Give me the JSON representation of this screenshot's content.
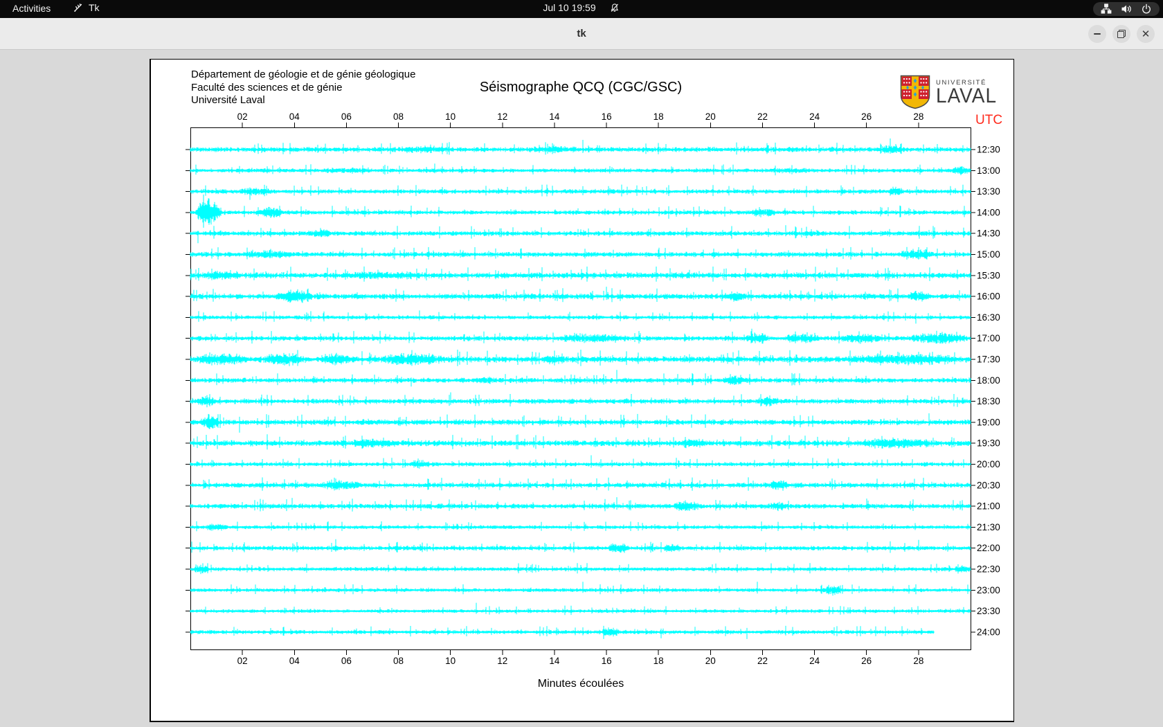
{
  "topbar": {
    "activities": "Activities",
    "app_name": "Tk",
    "clock": "Jul 10  19:59"
  },
  "window": {
    "title": "tk"
  },
  "icons": {
    "close": "✕"
  },
  "colors": {
    "trace": "#00ffff",
    "axis": "#000000",
    "utc_label": "#ff2a1c",
    "canvas_bg": "#ffffff",
    "window_bg": "#d9d9d9",
    "topbar_bg": "#0a0a0a",
    "titlebar_bg": "#ebebeb",
    "logo_red": "#cf202e",
    "logo_gold": "#f2b705",
    "logo_blue": "#2a9fd8"
  },
  "canvas": {
    "header_lines": [
      "Département de géologie et de génie géologique",
      "Faculté des sciences et de génie",
      "Université Laval"
    ],
    "title": "Séismographe QCQ (CGC/GSC)",
    "utc": "UTC",
    "xlabel": "Minutes écoulées",
    "logo": {
      "top": "UNIVERSITÉ",
      "name": "LAVAL"
    }
  },
  "chart_data": {
    "type": "seismogram-helicorder",
    "title": "Séismographe QCQ (CGC/GSC)",
    "xlabel": "Minutes écoulées",
    "ylabel": "UTC",
    "x_range_minutes": [
      0,
      30
    ],
    "x_tick_minutes": [
      2,
      4,
      6,
      8,
      10,
      12,
      14,
      16,
      18,
      20,
      22,
      24,
      26,
      28
    ],
    "x_tick_labels": [
      "02",
      "04",
      "06",
      "08",
      "10",
      "12",
      "14",
      "16",
      "18",
      "20",
      "22",
      "24",
      "26",
      "28"
    ],
    "minutes_per_row": 30,
    "rows": [
      {
        "time": "12:30",
        "base": 2.2,
        "bursts": [
          [
            8,
            10,
            1.5
          ],
          [
            13,
            15,
            1.5
          ],
          [
            26.6,
            27.3,
            4
          ]
        ],
        "spikes": [
          [
            11.3,
            9,
            4
          ],
          [
            15.1,
            14,
            5
          ],
          [
            18.3,
            8,
            3
          ],
          [
            23.7,
            6,
            3
          ],
          [
            26.9,
            16,
            6
          ]
        ]
      },
      {
        "time": "13:00",
        "base": 1.8,
        "bursts": [
          [
            5,
            7,
            1
          ],
          [
            22,
            24,
            1
          ],
          [
            29.3,
            30,
            3
          ]
        ],
        "spikes": [
          [
            9.4,
            10,
            4
          ],
          [
            10.1,
            5,
            3
          ],
          [
            16.2,
            5,
            2
          ],
          [
            22.5,
            7,
            7
          ],
          [
            29.6,
            5,
            5
          ]
        ]
      },
      {
        "time": "13:30",
        "base": 2.0,
        "bursts": [
          [
            1.8,
            3.2,
            2.5
          ],
          [
            26.8,
            27.4,
            3
          ]
        ],
        "spikes": [
          [
            2.3,
            6,
            12
          ],
          [
            12.9,
            7,
            3
          ],
          [
            20.9,
            5,
            2
          ],
          [
            23.7,
            8,
            8
          ]
        ]
      },
      {
        "time": "14:00",
        "base": 2.0,
        "bursts": [
          [
            0.2,
            1.2,
            14
          ],
          [
            2.6,
            3.6,
            4
          ],
          [
            21.5,
            22.5,
            3.5
          ]
        ],
        "spikes": [
          [
            0.5,
            26,
            22
          ],
          [
            3.0,
            8,
            4
          ],
          [
            6.0,
            9,
            3
          ],
          [
            9.1,
            7,
            3
          ],
          [
            14.9,
            6,
            2
          ],
          [
            18.4,
            9,
            9
          ],
          [
            18.7,
            6,
            6
          ],
          [
            26.6,
            7,
            3
          ]
        ]
      },
      {
        "time": "14:30",
        "base": 2.2,
        "bursts": [
          [
            4.5,
            5.5,
            2
          ]
        ],
        "spikes": [
          [
            0.3,
            4,
            14
          ],
          [
            5.0,
            8,
            3
          ],
          [
            12.4,
            9,
            4
          ],
          [
            15.0,
            6,
            3
          ],
          [
            22.9,
            12,
            4
          ],
          [
            26.2,
            5,
            3
          ],
          [
            28.0,
            4,
            4
          ]
        ]
      },
      {
        "time": "15:00",
        "base": 2.2,
        "bursts": [
          [
            2,
            4,
            2.5
          ],
          [
            27.3,
            28.6,
            4
          ]
        ],
        "spikes": [
          [
            3.1,
            8,
            3
          ],
          [
            18.0,
            7,
            3
          ],
          [
            23.0,
            6,
            4
          ],
          [
            27.8,
            8,
            6
          ]
        ]
      },
      {
        "time": "15:30",
        "base": 2.6,
        "bursts": [
          [
            0.5,
            2.0,
            3
          ],
          [
            6,
            9,
            1.5
          ]
        ],
        "spikes": [
          [
            2.9,
            6,
            3
          ],
          [
            19.2,
            8,
            4
          ],
          [
            24.4,
            7,
            3
          ]
        ]
      },
      {
        "time": "16:00",
        "base": 2.4,
        "bursts": [
          [
            3.3,
            4.7,
            5
          ],
          [
            20.6,
            21.4,
            4
          ],
          [
            27.6,
            28.4,
            4
          ]
        ],
        "spikes": [
          [
            2.8,
            7,
            3
          ],
          [
            10.5,
            6,
            3
          ],
          [
            16.0,
            14,
            5
          ],
          [
            24.6,
            6,
            3
          ],
          [
            28.0,
            6,
            4
          ]
        ]
      },
      {
        "time": "16:30",
        "base": 1.8,
        "bursts": [],
        "spikes": [
          [
            2.8,
            8,
            4
          ],
          [
            5.1,
            6,
            3
          ],
          [
            8.8,
            10,
            4
          ],
          [
            13.0,
            7,
            3
          ],
          [
            16.4,
            4,
            2
          ],
          [
            27.9,
            6,
            9
          ]
        ]
      },
      {
        "time": "17:00",
        "base": 2.2,
        "bursts": [
          [
            14.2,
            16.8,
            3
          ],
          [
            21.3,
            22.2,
            4
          ],
          [
            22.8,
            24.2,
            3.5
          ],
          [
            25.0,
            26.6,
            3.5
          ],
          [
            27.6,
            29.9,
            4
          ]
        ],
        "spikes": [
          [
            5.5,
            7,
            3
          ],
          [
            7.0,
            6,
            3
          ],
          [
            11.9,
            8,
            4
          ],
          [
            21.6,
            14,
            6
          ],
          [
            24.0,
            8,
            4
          ]
        ]
      },
      {
        "time": "17:30",
        "base": 2.8,
        "bursts": [
          [
            0.3,
            2.2,
            4
          ],
          [
            2.8,
            4.4,
            4.5
          ],
          [
            5.0,
            6.2,
            4
          ],
          [
            7.3,
            9.7,
            4.5
          ],
          [
            13.5,
            14.5,
            2.5
          ],
          [
            25.5,
            29.5,
            3.5
          ]
        ],
        "spikes": [
          [
            6.9,
            8,
            4
          ],
          [
            12.6,
            7,
            8
          ],
          [
            19.0,
            6,
            3
          ],
          [
            22.4,
            6,
            3
          ]
        ]
      },
      {
        "time": "18:00",
        "base": 2.2,
        "bursts": [
          [
            10.8,
            11.8,
            2
          ],
          [
            20.5,
            21.3,
            3.5
          ]
        ],
        "spikes": [
          [
            4.4,
            6,
            3
          ],
          [
            8.5,
            4,
            9
          ],
          [
            16.4,
            15,
            5
          ],
          [
            25.6,
            6,
            3
          ],
          [
            29.3,
            5,
            3
          ]
        ]
      },
      {
        "time": "18:30",
        "base": 2.2,
        "bursts": [
          [
            0.2,
            1.0,
            4
          ],
          [
            21.8,
            22.6,
            3.5
          ]
        ],
        "spikes": [
          [
            4.0,
            5,
            2
          ],
          [
            10.0,
            13,
            5
          ],
          [
            29.5,
            6,
            8
          ]
        ]
      },
      {
        "time": "19:00",
        "base": 2.4,
        "bursts": [
          [
            0.4,
            1.1,
            6
          ]
        ],
        "spikes": [
          [
            0.7,
            12,
            6
          ],
          [
            1.9,
            8,
            15
          ],
          [
            9.6,
            8,
            4
          ],
          [
            23.2,
            5,
            3
          ],
          [
            28.4,
            13,
            5
          ]
        ]
      },
      {
        "time": "19:30",
        "base": 2.6,
        "bursts": [
          [
            6.2,
            8.0,
            3
          ],
          [
            18.9,
            19.8,
            3
          ],
          [
            25.8,
            28.6,
            3.5
          ]
        ],
        "spikes": [
          [
            0.9,
            6,
            3
          ],
          [
            6.6,
            7,
            3
          ],
          [
            23.5,
            6,
            3
          ]
        ]
      },
      {
        "time": "20:00",
        "base": 1.9,
        "bursts": [
          [
            8.4,
            9.2,
            3
          ]
        ],
        "spikes": [
          [
            8.8,
            6,
            3
          ],
          [
            15.4,
            13,
            5
          ],
          [
            24.1,
            5,
            3
          ],
          [
            26.8,
            7,
            3
          ]
        ]
      },
      {
        "time": "20:30",
        "base": 2.3,
        "bursts": [
          [
            5.0,
            6.6,
            3
          ],
          [
            22.3,
            23.0,
            3.5
          ]
        ],
        "spikes": [
          [
            12.7,
            5,
            3
          ],
          [
            19.6,
            7,
            4
          ],
          [
            24.6,
            6,
            3
          ],
          [
            29.0,
            5,
            2
          ]
        ]
      },
      {
        "time": "21:00",
        "base": 2.2,
        "bursts": [
          [
            18.6,
            19.6,
            4
          ],
          [
            22.3,
            23.0,
            3
          ]
        ],
        "spikes": [
          [
            2.0,
            6,
            4
          ],
          [
            3.9,
            12,
            5
          ],
          [
            10.8,
            6,
            3
          ],
          [
            12.1,
            5,
            3
          ],
          [
            16.4,
            13,
            5
          ],
          [
            21.0,
            6,
            3
          ],
          [
            26.0,
            11,
            4
          ]
        ]
      },
      {
        "time": "21:30",
        "base": 1.7,
        "bursts": [
          [
            0.6,
            1.4,
            2.5
          ]
        ],
        "spikes": [
          [
            10.8,
            6,
            3
          ],
          [
            15.2,
            5,
            2
          ],
          [
            24.5,
            4,
            2
          ]
        ]
      },
      {
        "time": "22:00",
        "base": 2.0,
        "bursts": [
          [
            16.1,
            16.9,
            4
          ],
          [
            18.2,
            18.9,
            3
          ]
        ],
        "spikes": [
          [
            5.6,
            13,
            5
          ],
          [
            11.8,
            6,
            3
          ],
          [
            13.1,
            5,
            2
          ],
          [
            21.0,
            5,
            2
          ],
          [
            28.0,
            12,
            4
          ]
        ]
      },
      {
        "time": "22:30",
        "base": 1.8,
        "bursts": [
          [
            0.1,
            0.7,
            3
          ],
          [
            29.4,
            30,
            3.5
          ]
        ],
        "spikes": [
          [
            9.0,
            4,
            2
          ],
          [
            15.0,
            6,
            3
          ]
        ]
      },
      {
        "time": "23:00",
        "base": 1.7,
        "bursts": [
          [
            24.3,
            25.1,
            4
          ]
        ],
        "spikes": [
          [
            15.1,
            12,
            4
          ],
          [
            21.8,
            12,
            5
          ],
          [
            23.1,
            4,
            2
          ]
        ]
      },
      {
        "time": "23:30",
        "base": 1.6,
        "bursts": [],
        "spikes": [
          [
            11.0,
            12,
            4
          ],
          [
            16.0,
            4,
            2
          ],
          [
            21.1,
            5,
            2
          ]
        ]
      },
      {
        "time": "24:00",
        "base": 1.8,
        "end": 28.6,
        "bursts": [
          [
            15.8,
            16.5,
            3
          ]
        ],
        "spikes": [
          [
            10.9,
            4,
            2
          ],
          [
            15.9,
            9,
            10
          ],
          [
            18.1,
            5,
            9
          ],
          [
            21.4,
            6,
            10
          ],
          [
            22.9,
            9,
            5
          ]
        ]
      }
    ]
  }
}
